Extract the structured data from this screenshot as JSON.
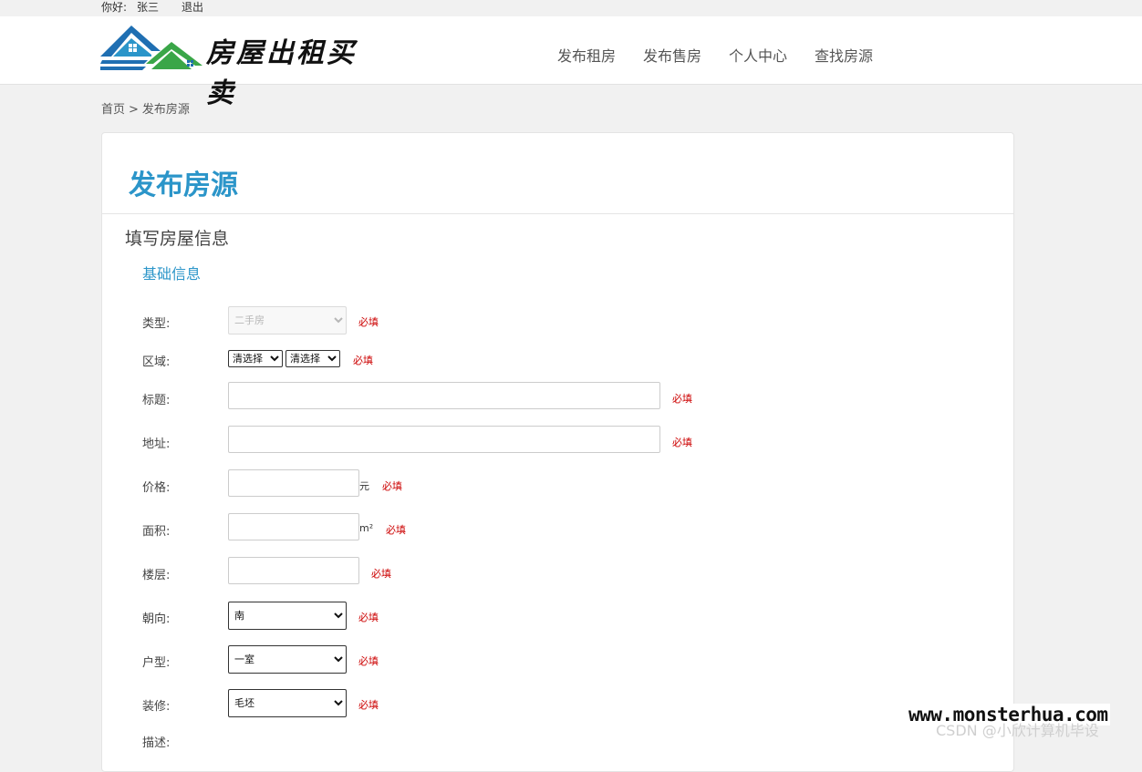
{
  "topbar": {
    "greeting": "你好:",
    "username": "张三",
    "logout": "退出"
  },
  "header": {
    "logo_text": "房屋出租买卖",
    "nav": [
      "发布租房",
      "发布售房",
      "个人中心",
      "查找房源"
    ]
  },
  "breadcrumb": {
    "home": "首页",
    "sep": ">",
    "current": "发布房源"
  },
  "card": {
    "title": "发布房源",
    "section_title": "填写房屋信息",
    "subsection_title": "基础信息"
  },
  "form": {
    "required": "必填",
    "type": {
      "label": "类型:",
      "value": "二手房"
    },
    "region": {
      "label": "区域:",
      "select1": "清选择",
      "select2": "清选择"
    },
    "title": {
      "label": "标题:",
      "value": ""
    },
    "address": {
      "label": "地址:",
      "value": ""
    },
    "price": {
      "label": "价格:",
      "value": "",
      "unit": "元"
    },
    "area": {
      "label": "面积:",
      "value": "",
      "unit": "m²"
    },
    "floor": {
      "label": "楼层:",
      "value": ""
    },
    "orientation": {
      "label": "朝向:",
      "value": "南"
    },
    "layout": {
      "label": "户型:",
      "value": "一室"
    },
    "decoration": {
      "label": "装修:",
      "value": "毛坯"
    },
    "description": {
      "label": "描述:"
    }
  },
  "watermark": {
    "site": "www.monsterhua.com",
    "csdn": "CSDN @小欣计算机毕设"
  },
  "colors": {
    "accent": "#2b95c9",
    "required": "#cc0000",
    "logo_blue": "#1f6fb2",
    "logo_green": "#3aa648"
  }
}
